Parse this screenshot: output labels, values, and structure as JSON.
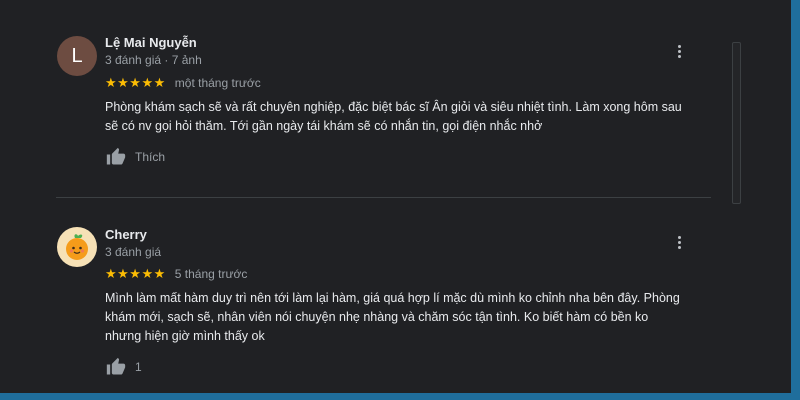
{
  "reviews": [
    {
      "avatar_letter": "L",
      "name": "Lệ Mai Nguyễn",
      "meta": "3 đánh giá · 7 ảnh",
      "stars": "★★★★★",
      "rating": 5,
      "time": "một tháng trước",
      "text_lines": [
        "Phòng khám sạch sẽ và rất chuyên nghiệp, đặc biệt bác sĩ Ân giỏi và siêu nhiệt tình. Làm xong hôm sau",
        "sẽ có nv gọi hỏi thăm. Tới gần ngày tái khám sẽ có nhắn tin, gọi điện nhắc nhở"
      ],
      "like_label": "Thích"
    },
    {
      "name": "Cherry",
      "meta": "3 đánh giá",
      "stars": "★★★★★",
      "rating": 5,
      "time": "5 tháng trước",
      "text_lines": [
        "Mình làm mất hàm duy trì nên tới làm lại hàm, giá quá hợp lí mặc dù mình ko chỉnh nha bên đây. Phòng",
        "khám mới, sạch sẽ, nhân viên nói chuyện nhẹ nhàng và chăm sóc tận tình. Ko biết hàm có bền ko",
        "nhưng hiện giờ mình thấy ok"
      ],
      "like_label": "1"
    }
  ],
  "colors": {
    "background": "#202124",
    "star": "#fbbc04",
    "avatar_letter_bg": "#6d4c41",
    "frame": "#1f6e9c"
  },
  "icons": {
    "like": "thumbs-up-icon",
    "more": "more-vert-icon"
  }
}
